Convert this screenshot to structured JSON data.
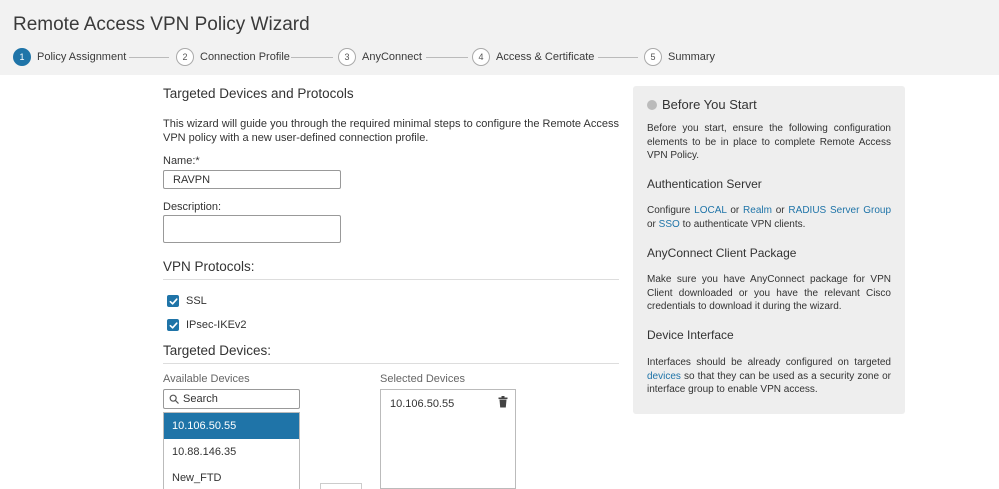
{
  "header": {
    "title": "Remote Access VPN Policy Wizard",
    "steps": [
      {
        "num": "1",
        "label": "Policy Assignment"
      },
      {
        "num": "2",
        "label": "Connection Profile"
      },
      {
        "num": "3",
        "label": "AnyConnect"
      },
      {
        "num": "4",
        "label": "Access & Certificate"
      },
      {
        "num": "5",
        "label": "Summary"
      }
    ]
  },
  "form": {
    "section_title": "Targeted Devices and Protocols",
    "intro": "This wizard will guide you through the required minimal steps to configure the Remote Access VPN policy with a new user-defined connection profile.",
    "name_label": "Name:*",
    "name_value": "RAVPN",
    "description_label": "Description:",
    "description_value": "",
    "vpn_protocols_title": "VPN Protocols:",
    "protocols": [
      {
        "label": "SSL",
        "checked": true
      },
      {
        "label": "IPsec-IKEv2",
        "checked": true
      }
    ],
    "targeted_devices_title": "Targeted Devices:",
    "available_label": "Available Devices",
    "selected_label": "Selected Devices",
    "search_placeholder": "Search",
    "available_devices": [
      "10.106.50.55",
      "10.88.146.35",
      "New_FTD"
    ],
    "selected_devices": [
      "10.106.50.55"
    ]
  },
  "info": {
    "title": "Before You Start",
    "intro": "Before you start, ensure the following configuration elements to be in place to complete Remote Access VPN Policy.",
    "auth_title": "Authentication Server",
    "auth": {
      "p1": "Configure ",
      "local": "LOCAL",
      "p2": " or ",
      "realm": "Realm",
      "p3": " or ",
      "radius": "RADIUS Server Group",
      "p4": " or ",
      "sso": "SSO",
      "p5": " to authenticate VPN clients."
    },
    "anyconnect_title": "AnyConnect Client Package",
    "anyconnect_text": "Make sure you have AnyConnect package for VPN Client downloaded or you have the relevant Cisco credentials to download it during the wizard.",
    "device_title": "Device Interface",
    "device": {
      "p1": "Interfaces should be already configured on targeted ",
      "devices": "devices",
      "p2": " so that they can be used as a security zone or interface group to enable VPN access."
    }
  },
  "colors": {
    "accent": "#1f74a8",
    "panel": "#eeeeee",
    "header": "#f2f2f2"
  }
}
